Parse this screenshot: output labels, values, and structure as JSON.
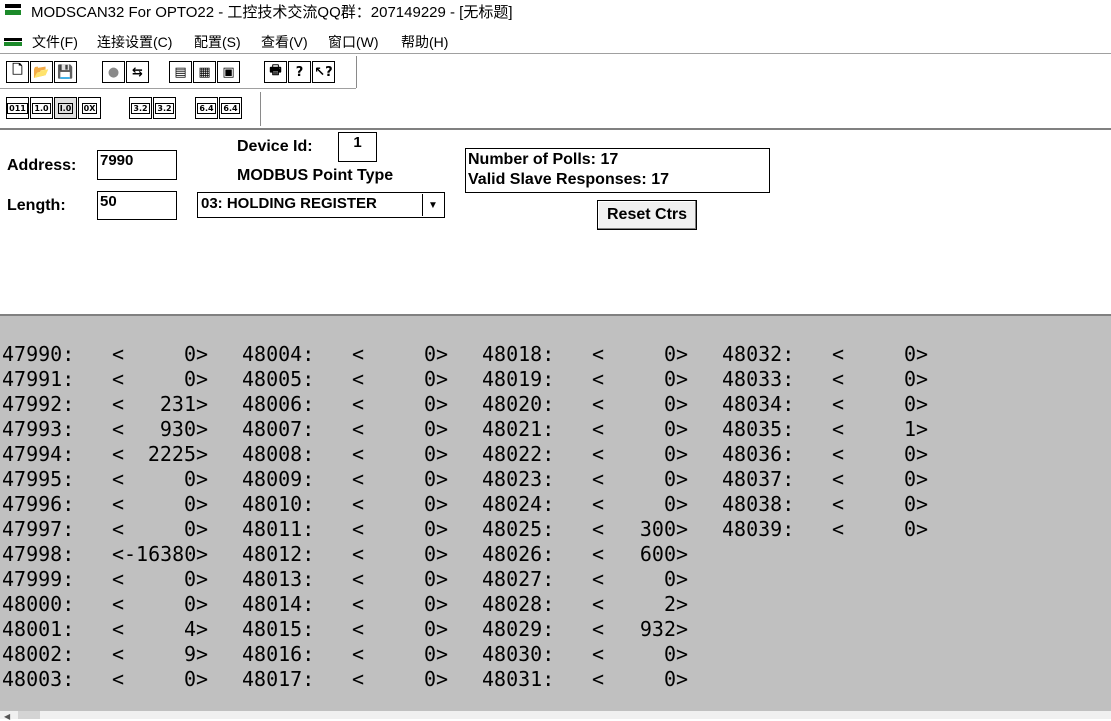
{
  "window": {
    "title": "MODSCAN32 For OPTO22 - 工控技术交流QQ群：207149229 - [无标题]"
  },
  "menu": {
    "items": [
      "文件(F)",
      "连接设置(C)",
      "配置(S)",
      "查看(V)",
      "窗口(W)",
      "帮助(H)"
    ]
  },
  "toolbar1": {
    "group1": [
      "🗋",
      "📂",
      "💾"
    ],
    "group2": [
      "●",
      "⇆"
    ],
    "group3": [
      "▤",
      "▦",
      "▣"
    ],
    "group4": [
      "🖶",
      "?",
      "↖?"
    ]
  },
  "toolbar2": {
    "group1": [
      "011",
      "1.0",
      "I.0",
      "0X"
    ],
    "group2": [
      "3.2",
      "3.2"
    ],
    "group3": [
      "6.4",
      "6.4"
    ]
  },
  "config": {
    "address_label": "Address:",
    "address_value": "7990",
    "length_label": "Length:",
    "length_value": "50",
    "device_id_label": "Device Id:",
    "device_id_value": "1",
    "point_type_label": "MODBUS Point Type",
    "point_type_value": "03: HOLDING REGISTER",
    "polls_line": "Number of Polls: 17",
    "responses_line": "Valid Slave Responses: 17",
    "reset_label": "Reset Ctrs"
  },
  "registers": {
    "col1": [
      {
        "addr": "47990:",
        "val": "0"
      },
      {
        "addr": "47991:",
        "val": "0"
      },
      {
        "addr": "47992:",
        "val": "231"
      },
      {
        "addr": "47993:",
        "val": "930"
      },
      {
        "addr": "47994:",
        "val": "2225"
      },
      {
        "addr": "47995:",
        "val": "0"
      },
      {
        "addr": "47996:",
        "val": "0"
      },
      {
        "addr": "47997:",
        "val": "0"
      },
      {
        "addr": "47998:",
        "val": "-16380"
      },
      {
        "addr": "47999:",
        "val": "0"
      },
      {
        "addr": "48000:",
        "val": "0"
      },
      {
        "addr": "48001:",
        "val": "4"
      },
      {
        "addr": "48002:",
        "val": "9"
      },
      {
        "addr": "48003:",
        "val": "0"
      }
    ],
    "col2": [
      {
        "addr": "48004:",
        "val": "0"
      },
      {
        "addr": "48005:",
        "val": "0"
      },
      {
        "addr": "48006:",
        "val": "0"
      },
      {
        "addr": "48007:",
        "val": "0"
      },
      {
        "addr": "48008:",
        "val": "0"
      },
      {
        "addr": "48009:",
        "val": "0"
      },
      {
        "addr": "48010:",
        "val": "0"
      },
      {
        "addr": "48011:",
        "val": "0"
      },
      {
        "addr": "48012:",
        "val": "0"
      },
      {
        "addr": "48013:",
        "val": "0"
      },
      {
        "addr": "48014:",
        "val": "0"
      },
      {
        "addr": "48015:",
        "val": "0"
      },
      {
        "addr": "48016:",
        "val": "0"
      },
      {
        "addr": "48017:",
        "val": "0"
      }
    ],
    "col3": [
      {
        "addr": "48018:",
        "val": "0"
      },
      {
        "addr": "48019:",
        "val": "0"
      },
      {
        "addr": "48020:",
        "val": "0"
      },
      {
        "addr": "48021:",
        "val": "0"
      },
      {
        "addr": "48022:",
        "val": "0"
      },
      {
        "addr": "48023:",
        "val": "0"
      },
      {
        "addr": "48024:",
        "val": "0"
      },
      {
        "addr": "48025:",
        "val": "300"
      },
      {
        "addr": "48026:",
        "val": "600"
      },
      {
        "addr": "48027:",
        "val": "0"
      },
      {
        "addr": "48028:",
        "val": "2"
      },
      {
        "addr": "48029:",
        "val": "932"
      },
      {
        "addr": "48030:",
        "val": "0"
      },
      {
        "addr": "48031:",
        "val": "0"
      }
    ],
    "col4": [
      {
        "addr": "48032:",
        "val": "0"
      },
      {
        "addr": "48033:",
        "val": "0"
      },
      {
        "addr": "48034:",
        "val": "0"
      },
      {
        "addr": "48035:",
        "val": "1"
      },
      {
        "addr": "48036:",
        "val": "0"
      },
      {
        "addr": "48037:",
        "val": "0"
      },
      {
        "addr": "48038:",
        "val": "0"
      },
      {
        "addr": "48039:",
        "val": "0"
      }
    ]
  }
}
